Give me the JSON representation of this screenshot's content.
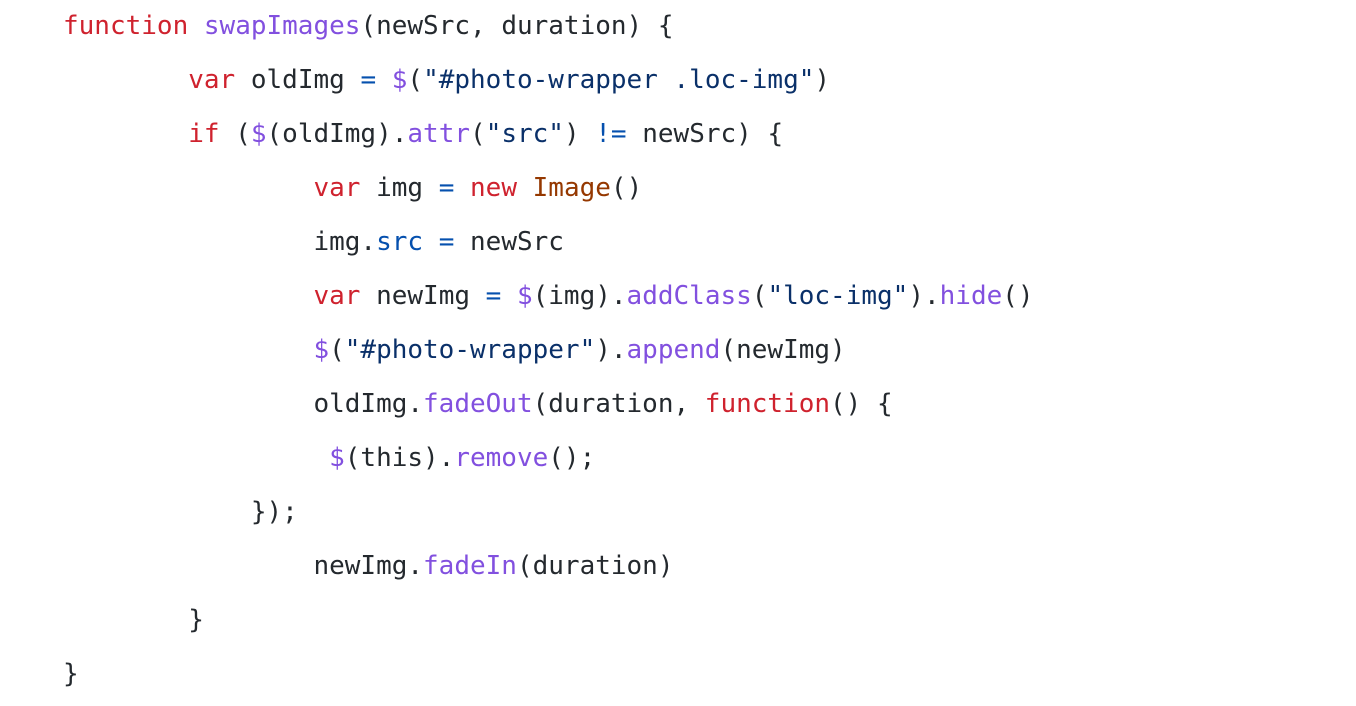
{
  "colors": {
    "background": "#ffffff",
    "plain": "#24292e",
    "keyword": "#cf222e",
    "function_name": "#8250df",
    "string": "#0a3069",
    "property": "#0550ae",
    "class": "#953800"
  },
  "code": {
    "language": "javascript",
    "lines": [
      {
        "indent": "",
        "tokens": [
          {
            "t": "kw",
            "v": "function"
          },
          {
            "t": "id",
            "v": " "
          },
          {
            "t": "fn",
            "v": "swapImages"
          },
          {
            "t": "id",
            "v": "(newSrc, duration) {"
          }
        ]
      },
      {
        "indent": "        ",
        "tokens": [
          {
            "t": "kw",
            "v": "var"
          },
          {
            "t": "id",
            "v": " oldImg "
          },
          {
            "t": "op",
            "v": "="
          },
          {
            "t": "id",
            "v": " "
          },
          {
            "t": "fn",
            "v": "$"
          },
          {
            "t": "id",
            "v": "("
          },
          {
            "t": "str",
            "v": "\"#photo-wrapper .loc-img\""
          },
          {
            "t": "id",
            "v": ")"
          }
        ]
      },
      {
        "indent": "        ",
        "tokens": [
          {
            "t": "kw",
            "v": "if"
          },
          {
            "t": "id",
            "v": " ("
          },
          {
            "t": "fn",
            "v": "$"
          },
          {
            "t": "id",
            "v": "(oldImg)."
          },
          {
            "t": "fn",
            "v": "attr"
          },
          {
            "t": "id",
            "v": "("
          },
          {
            "t": "str",
            "v": "\"src\""
          },
          {
            "t": "id",
            "v": ") "
          },
          {
            "t": "op",
            "v": "!="
          },
          {
            "t": "id",
            "v": " newSrc) {"
          }
        ]
      },
      {
        "indent": "                ",
        "tokens": [
          {
            "t": "kw",
            "v": "var"
          },
          {
            "t": "id",
            "v": " img "
          },
          {
            "t": "op",
            "v": "="
          },
          {
            "t": "id",
            "v": " "
          },
          {
            "t": "kw",
            "v": "new"
          },
          {
            "t": "id",
            "v": " "
          },
          {
            "t": "cls",
            "v": "Image"
          },
          {
            "t": "id",
            "v": "()"
          }
        ]
      },
      {
        "indent": "                ",
        "tokens": [
          {
            "t": "id",
            "v": "img."
          },
          {
            "t": "prop",
            "v": "src"
          },
          {
            "t": "id",
            "v": " "
          },
          {
            "t": "op",
            "v": "="
          },
          {
            "t": "id",
            "v": " newSrc"
          }
        ]
      },
      {
        "indent": "                ",
        "tokens": [
          {
            "t": "kw",
            "v": "var"
          },
          {
            "t": "id",
            "v": " newImg "
          },
          {
            "t": "op",
            "v": "="
          },
          {
            "t": "id",
            "v": " "
          },
          {
            "t": "fn",
            "v": "$"
          },
          {
            "t": "id",
            "v": "(img)."
          },
          {
            "t": "fn",
            "v": "addClass"
          },
          {
            "t": "id",
            "v": "("
          },
          {
            "t": "str",
            "v": "\"loc-img\""
          },
          {
            "t": "id",
            "v": ")."
          },
          {
            "t": "fn",
            "v": "hide"
          },
          {
            "t": "id",
            "v": "()"
          }
        ]
      },
      {
        "indent": "                ",
        "tokens": [
          {
            "t": "fn",
            "v": "$"
          },
          {
            "t": "id",
            "v": "("
          },
          {
            "t": "str",
            "v": "\"#photo-wrapper\""
          },
          {
            "t": "id",
            "v": ")."
          },
          {
            "t": "fn",
            "v": "append"
          },
          {
            "t": "id",
            "v": "(newImg)"
          }
        ]
      },
      {
        "indent": "                ",
        "tokens": [
          {
            "t": "id",
            "v": "oldImg."
          },
          {
            "t": "fn",
            "v": "fadeOut"
          },
          {
            "t": "id",
            "v": "(duration, "
          },
          {
            "t": "kw",
            "v": "function"
          },
          {
            "t": "id",
            "v": "() {"
          }
        ]
      },
      {
        "indent": "                 ",
        "tokens": [
          {
            "t": "fn",
            "v": "$"
          },
          {
            "t": "id",
            "v": "(this)."
          },
          {
            "t": "fn",
            "v": "remove"
          },
          {
            "t": "id",
            "v": "();"
          }
        ]
      },
      {
        "indent": "            ",
        "tokens": [
          {
            "t": "id",
            "v": "});"
          }
        ]
      },
      {
        "indent": "                ",
        "tokens": [
          {
            "t": "id",
            "v": "newImg."
          },
          {
            "t": "fn",
            "v": "fadeIn"
          },
          {
            "t": "id",
            "v": "(duration)"
          }
        ]
      },
      {
        "indent": "        ",
        "tokens": [
          {
            "t": "id",
            "v": "}"
          }
        ]
      },
      {
        "indent": "",
        "tokens": [
          {
            "t": "id",
            "v": "}"
          }
        ]
      }
    ]
  }
}
